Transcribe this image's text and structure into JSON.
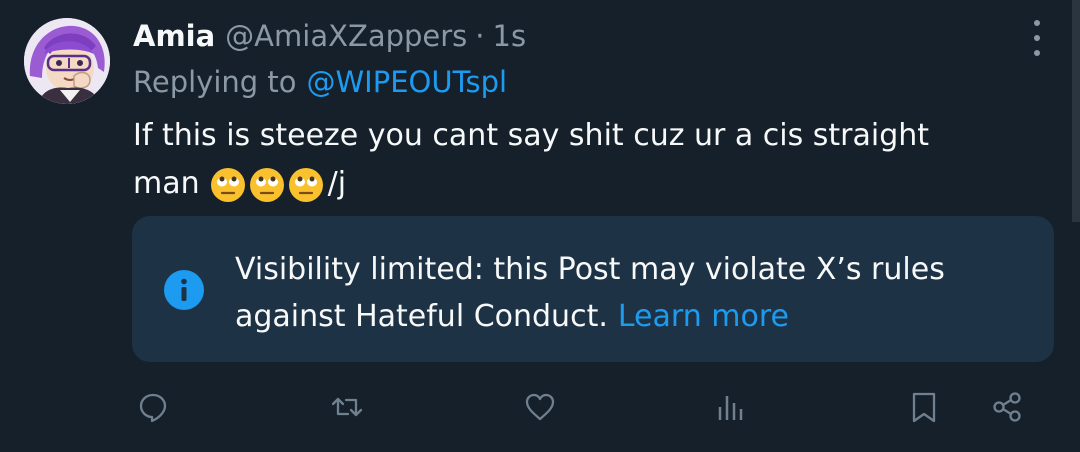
{
  "post": {
    "display_name": "Amia",
    "handle": "@AmiaXZappers",
    "separator": "·",
    "timestamp": "1s",
    "reply_prefix": "Replying to",
    "reply_to": "@WIPEOUTspl",
    "text_line1": "If this is steeze you cant say shit cuz ur a cis straight",
    "text_line2_start": "man",
    "text_emojis": "🙄🙄🙄",
    "text_line2_end": "/j"
  },
  "notice": {
    "line1": "Visibility limited: this Post may violate X’s rules",
    "line2": "against Hateful Conduct.",
    "link": "Learn more",
    "icon": "info-icon"
  },
  "colors": {
    "background": "#15202b",
    "notice_background": "#1e3245",
    "accent": "#1d9bf0",
    "text": "#f7f9f9",
    "muted": "#8b98a5"
  },
  "actions": [
    "reply-icon",
    "repost-icon",
    "like-icon",
    "views-icon",
    "bookmark-icon",
    "share-icon"
  ]
}
